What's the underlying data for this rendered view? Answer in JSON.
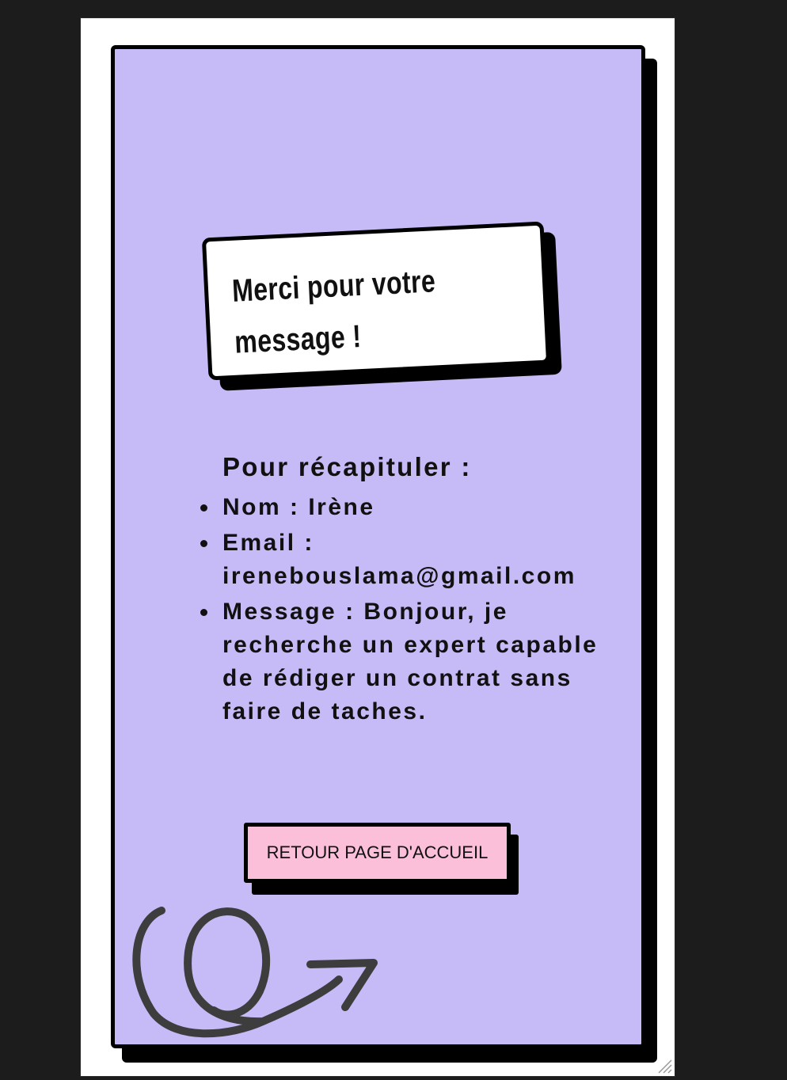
{
  "confirmation": {
    "title": "Merci pour votre message !"
  },
  "recap": {
    "heading": "Pour récapituler :",
    "items": [
      {
        "text": "Nom : Irène"
      },
      {
        "text": "Email : irenebouslama@gmail.com"
      },
      {
        "text": "Message : Bonjour, je recherche un expert capable de rédiger un contrat sans faire de taches."
      }
    ]
  },
  "actions": {
    "home_button_label": "RETOUR PAGE D'ACCUEIL"
  },
  "colors": {
    "page_background": "#1c1c1d",
    "card_background": "#c7bbf7",
    "title_background": "#ffffff",
    "button_background": "#fbbfd9",
    "shadow": "#000000",
    "text": "#111111"
  },
  "icons": {
    "decoration": "squiggle-arrow-icon",
    "bullet": "bullet-icon",
    "resize": "resize-grip-icon"
  }
}
